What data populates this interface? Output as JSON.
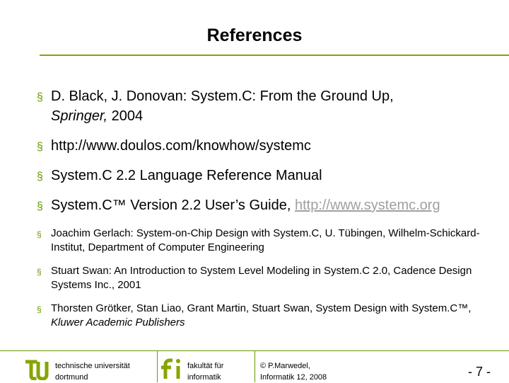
{
  "slide": {
    "title": "References",
    "references": [
      {
        "text": "D. Black, J. Donovan: System.C: From the Ground Up,",
        "italic_part": "Springer,",
        "tail": " 2004"
      },
      {
        "text": "http://www.doulos.com/knowhow/systemc"
      },
      {
        "text": "System.C 2.2 Language Reference Manual"
      },
      {
        "text": "System.C™ Version 2.2 User’s Guide, ",
        "link": "http://www.systemc.org"
      },
      {
        "text": "Joachim Gerlach: System-on-Chip Design with System.C, U. Tübingen, Wilhelm-Schickard-Institut, Department of Computer Engineering"
      },
      {
        "text": "Stuart Swan: An Introduction to System Level Modeling in System.C 2.0, Cadence Design Systems Inc., 2001"
      },
      {
        "text": "Thorsten Grötker, Stan Liao, Grant Martin, Stuart Swan, System Design with System.C™, ",
        "italic_part": "Kluwer Academic Publishers"
      }
    ],
    "bullet_glyph": "§"
  },
  "footer": {
    "university_line1": "technische universität",
    "university_line2": "dortmund",
    "faculty_line1": "fakultät für",
    "faculty_line2": "informatik",
    "author_line1": "© P.Marwedel,",
    "author_line2": "Informatik 12,  2008",
    "page": "-  7 -"
  },
  "colors": {
    "accent_green": "#86a500",
    "bullet_green": "#6b9a00",
    "link_gray": "#a0a0a0"
  }
}
